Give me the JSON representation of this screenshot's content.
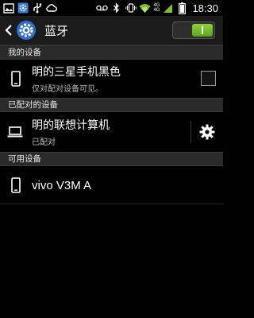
{
  "status_bar": {
    "time": "18:30",
    "network_top": "4G",
    "network_bottom": "4G",
    "icons_left": [
      "image-icon",
      "settings-icon",
      "usb-icon",
      "cloud-icon"
    ],
    "icons_right": [
      "voicemail-icon",
      "bluetooth-icon",
      "vibrate-icon",
      "wifi-icon",
      "signal-icon",
      "battery-icon"
    ]
  },
  "action_bar": {
    "title": "蓝牙",
    "toggle_on": true,
    "accent": "#7cc232"
  },
  "sections": {
    "my_device": "我的设备",
    "paired": "已配对的设备",
    "available": "可用设备"
  },
  "my_device": {
    "name": "明的三星手机黑色",
    "subtitle": "仅对配对设备可见。",
    "visible_checked": false
  },
  "paired_device": {
    "name": "明的联想计算机",
    "status": "已配对"
  },
  "available_device": {
    "name": "vivo V3M A"
  }
}
